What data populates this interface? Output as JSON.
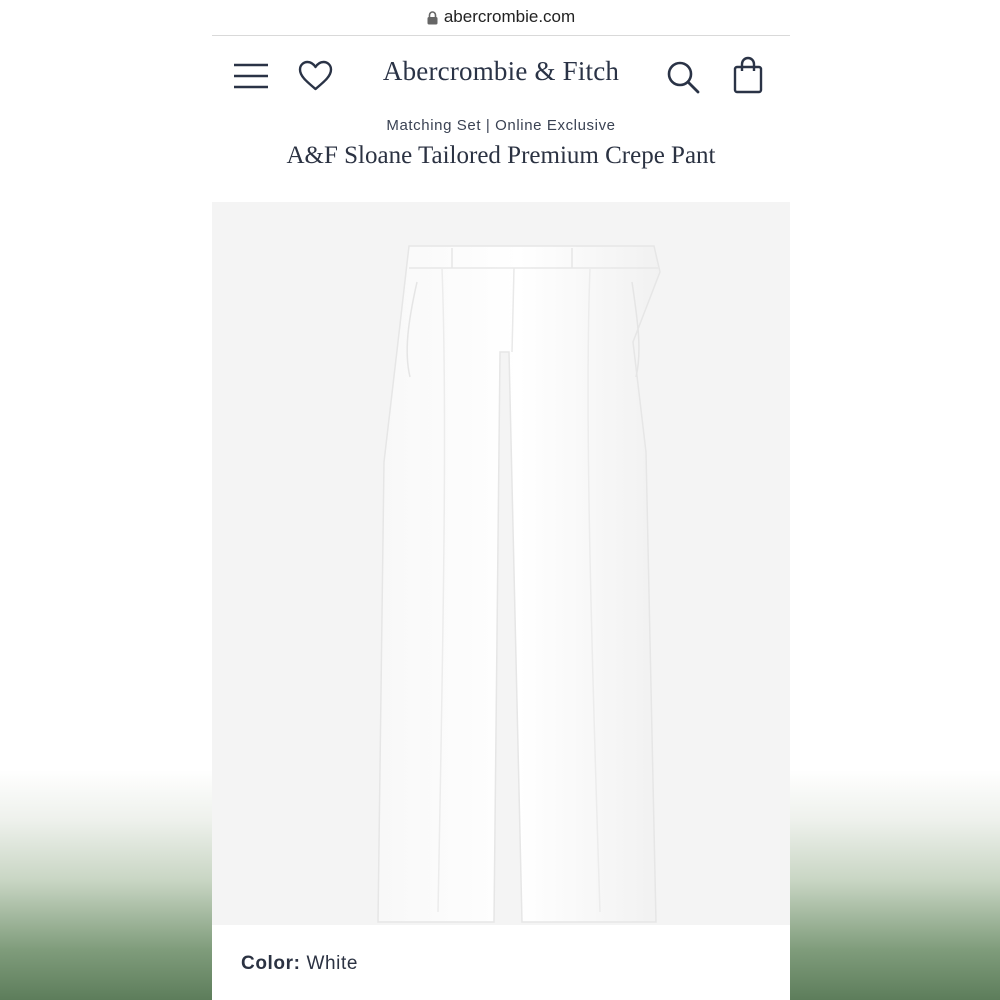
{
  "browser": {
    "url": "abercrombie.com"
  },
  "header": {
    "brand": "Abercrombie & Fitch",
    "icons": [
      "menu-icon",
      "heart-icon",
      "search-icon",
      "shopping-bag-icon"
    ]
  },
  "product": {
    "subtitle": "Matching Set | Online Exclusive",
    "title": "A&F Sloane Tailored Premium Crepe Pant",
    "color_label": "Color:",
    "color_value": "White"
  },
  "colors": {
    "brand_navy": "#2a3346",
    "image_background": "#f4f4f4"
  }
}
